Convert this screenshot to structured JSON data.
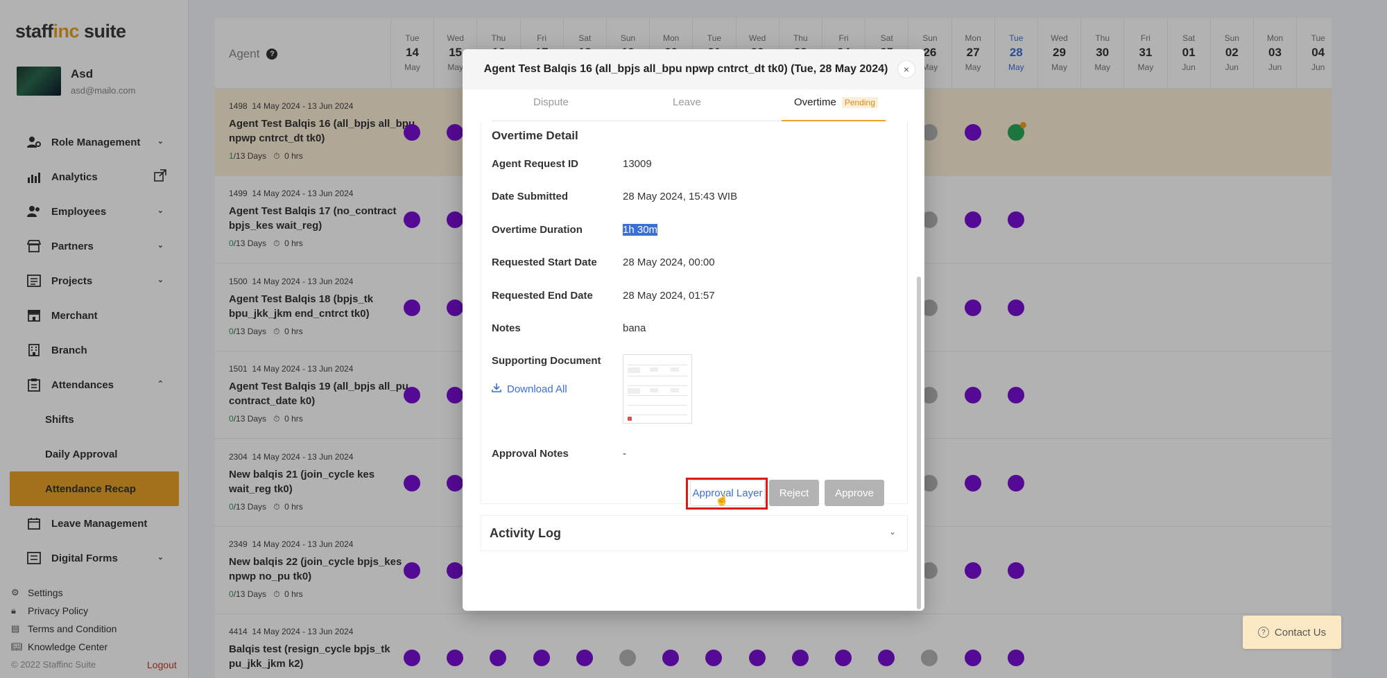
{
  "brand": {
    "part1": "staff",
    "part2": "inc",
    "part3": " suite"
  },
  "user": {
    "name": "Asd",
    "email": "asd@mailo.com"
  },
  "nav": [
    {
      "label": "Role Management",
      "icon": "users-cog-icon",
      "has_chevron": true
    },
    {
      "label": "Analytics",
      "icon": "bar-chart-icon",
      "has_external": true
    },
    {
      "label": "Employees",
      "icon": "people-icon",
      "has_chevron": true
    },
    {
      "label": "Partners",
      "icon": "store-icon",
      "has_chevron": true
    },
    {
      "label": "Projects",
      "icon": "list-icon",
      "has_chevron": true
    },
    {
      "label": "Merchant",
      "icon": "shop-icon"
    },
    {
      "label": "Branch",
      "icon": "building-icon"
    },
    {
      "label": "Attendances",
      "icon": "clipboard-icon",
      "has_chevron": true,
      "expanded": true
    }
  ],
  "nav_sub": [
    "Shifts",
    "Daily Approval",
    "Attendance Recap"
  ],
  "nav_after": [
    {
      "label": "Leave Management",
      "icon": "calendar-icon"
    },
    {
      "label": "Digital Forms",
      "icon": "form-icon",
      "has_chevron": true
    }
  ],
  "footer": {
    "links": [
      "Settings",
      "Privacy Policy",
      "Terms and Condition",
      "Knowledge Center"
    ],
    "copyright": "© 2022 Staffinc Suite",
    "logout": "Logout"
  },
  "calendar": {
    "agent_label": "Agent",
    "days": [
      {
        "dn": "Tue",
        "dd": "14",
        "dm": "May"
      },
      {
        "dn": "Wed",
        "dd": "15",
        "dm": "May"
      },
      {
        "dn": "Thu",
        "dd": "16",
        "dm": "May"
      },
      {
        "dn": "Fri",
        "dd": "17",
        "dm": "May"
      },
      {
        "dn": "Sat",
        "dd": "18",
        "dm": "May"
      },
      {
        "dn": "Sun",
        "dd": "19",
        "dm": "May"
      },
      {
        "dn": "Mon",
        "dd": "20",
        "dm": "May"
      },
      {
        "dn": "Tue",
        "dd": "21",
        "dm": "May"
      },
      {
        "dn": "Wed",
        "dd": "22",
        "dm": "May"
      },
      {
        "dn": "Thu",
        "dd": "23",
        "dm": "May"
      },
      {
        "dn": "Fri",
        "dd": "24",
        "dm": "May"
      },
      {
        "dn": "Sat",
        "dd": "25",
        "dm": "May"
      },
      {
        "dn": "Sun",
        "dd": "26",
        "dm": "May"
      },
      {
        "dn": "Mon",
        "dd": "27",
        "dm": "May"
      },
      {
        "dn": "Tue",
        "dd": "28",
        "dm": "May",
        "today": true
      },
      {
        "dn": "Wed",
        "dd": "29",
        "dm": "May"
      },
      {
        "dn": "Thu",
        "dd": "30",
        "dm": "May"
      },
      {
        "dn": "Fri",
        "dd": "31",
        "dm": "May"
      },
      {
        "dn": "Sat",
        "dd": "01",
        "dm": "Jun"
      },
      {
        "dn": "Sun",
        "dd": "02",
        "dm": "Jun"
      },
      {
        "dn": "Mon",
        "dd": "03",
        "dm": "Jun"
      },
      {
        "dn": "Tue",
        "dd": "04",
        "dm": "Jun"
      }
    ],
    "rows": [
      {
        "id": "1498",
        "period": "14 May 2024 - 13 Jun 2024",
        "name": "Agent Test Balqis 16 (all_bpjs all_bpu npwp cntrct_dt tk0)",
        "done": "1",
        "days": "/13 Days",
        "hours": "0 hrs",
        "highlight": true,
        "dots": [
          "p",
          "p",
          "p",
          "p",
          "p",
          "g",
          "p",
          "p",
          "p",
          "p",
          "p",
          "p",
          "g",
          "p",
          "gr"
        ]
      },
      {
        "id": "1499",
        "period": "14 May 2024 - 13 Jun 2024",
        "name": "Agent Test Balqis 17 (no_contract bpjs_kes wait_reg)",
        "done": "0",
        "days": "/13 Days",
        "hours": "0 hrs",
        "dots": [
          "p",
          "p",
          "p",
          "p",
          "p",
          "g",
          "p",
          "p",
          "p",
          "p",
          "p",
          "p",
          "g",
          "p",
          "p"
        ]
      },
      {
        "id": "1500",
        "period": "14 May 2024 - 13 Jun 2024",
        "name": "Agent Test Balqis 18 (bpjs_tk bpu_jkk_jkm end_cntrct tk0)",
        "done": "0",
        "days": "/13 Days",
        "hours": "0 hrs",
        "dots": [
          "p",
          "p",
          "p",
          "p",
          "p",
          "g",
          "p",
          "p",
          "p",
          "p",
          "p",
          "p",
          "g",
          "p",
          "p"
        ]
      },
      {
        "id": "1501",
        "period": "14 May 2024 - 13 Jun 2024",
        "name": "Agent Test Balqis 19 (all_bpjs all_pu contract_date k0)",
        "done": "0",
        "days": "/13 Days",
        "hours": "0 hrs",
        "dots": [
          "p",
          "p",
          "p",
          "p",
          "p",
          "g",
          "p",
          "p",
          "p",
          "p",
          "p",
          "p",
          "g",
          "p",
          "p"
        ]
      },
      {
        "id": "2304",
        "period": "14 May 2024 - 13 Jun 2024",
        "name": "New balqis 21 (join_cycle kes wait_reg tk0)",
        "done": "0",
        "days": "/13 Days",
        "hours": "0 hrs",
        "dots": [
          "p",
          "p",
          "p",
          "p",
          "p",
          "g",
          "p",
          "p",
          "p",
          "p",
          "p",
          "p",
          "g",
          "p",
          "p"
        ]
      },
      {
        "id": "2349",
        "period": "14 May 2024 - 13 Jun 2024",
        "name": "New balqis 22 (join_cycle bpjs_kes npwp no_pu tk0)",
        "done": "0",
        "days": "/13 Days",
        "hours": "0 hrs",
        "dots": [
          "p",
          "p",
          "p",
          "p",
          "p",
          "g",
          "p",
          "p",
          "p",
          "p",
          "p",
          "p",
          "g",
          "p",
          "p"
        ]
      },
      {
        "id": "4414",
        "period": "14 May 2024 - 13 Jun 2024",
        "name": "Balqis test (resign_cycle bpjs_tk pu_jkk_jkm k2)",
        "done": "",
        "days": "",
        "hours": "",
        "dots": [
          "p",
          "p",
          "p",
          "p",
          "p",
          "g",
          "p",
          "p",
          "p",
          "p",
          "p",
          "p",
          "g",
          "p",
          "p"
        ]
      }
    ]
  },
  "contact": {
    "label": "Contact Us"
  },
  "modal": {
    "title": "Agent Test Balqis 16 (all_bpjs all_bpu npwp cntrct_dt tk0) (Tue, 28 May 2024)",
    "close": "×",
    "tabs": [
      "Dispute",
      "Leave",
      "Overtime"
    ],
    "pending": "Pending",
    "section_title": "Overtime Detail",
    "fields": [
      {
        "label": "Agent Request ID",
        "value": "13009"
      },
      {
        "label": "Date Submitted",
        "value": "28 May 2024, 15:43 WIB"
      },
      {
        "label": "Overtime Duration",
        "value": "1h 30m"
      },
      {
        "label": "Requested Start Date",
        "value": "28 May 2024, 00:00"
      },
      {
        "label": "Requested End Date",
        "value": "28 May 2024, 01:57"
      },
      {
        "label": "Notes",
        "value": "bana"
      }
    ],
    "supporting_label": "Supporting Document",
    "download_all": "Download All",
    "approval_notes_label": "Approval Notes",
    "approval_notes_value": "-",
    "buttons": {
      "layer": "Approval Layer",
      "reject": "Reject",
      "approve": "Approve"
    },
    "activity_log": "Activity Log"
  }
}
